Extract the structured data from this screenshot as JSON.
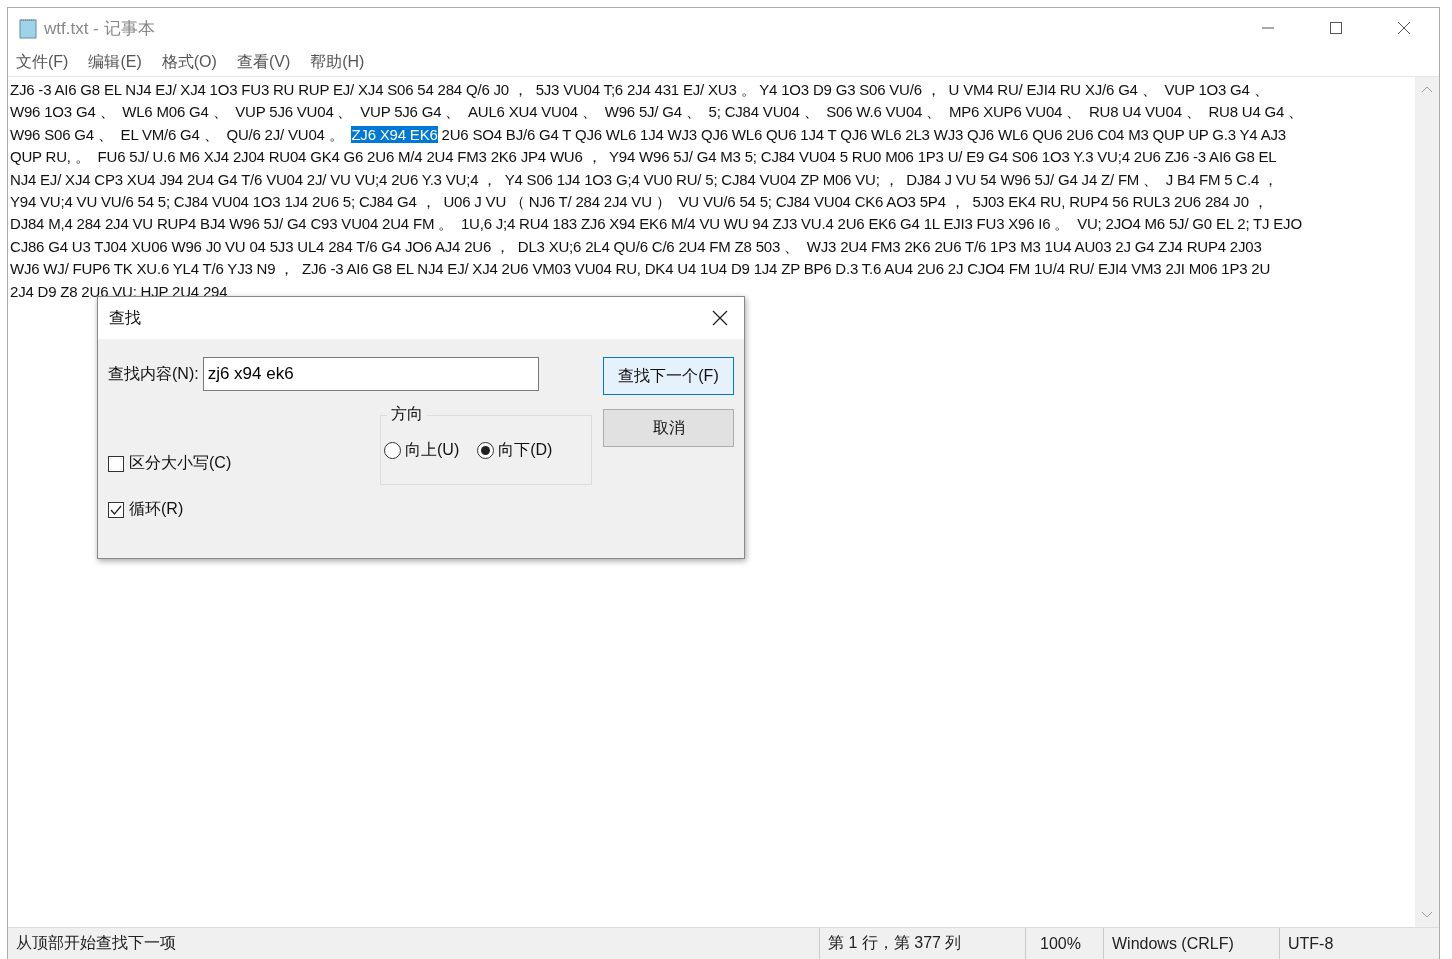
{
  "window": {
    "title": "wtf.txt - 记事本"
  },
  "menu": [
    "文件(F)",
    "编辑(E)",
    "格式(O)",
    "查看(V)",
    "帮助(H)"
  ],
  "editor": {
    "lines": [
      [
        {
          "text": "ZJ6 -3 AI6 G8 EL NJ4 EJ/ XJ4 1O3 FU3 RU RUP EJ/ XJ4 S06 54 284 Q/6 J0 ，  5J3 VU04 T;6 2J4 431 EJ/ XU3 。 Y4 1O3 D9 G3 S06 VU/6 ，  U VM4 RU/ EJI4 RU XJ/6 G4 、  VUP 1O3 G4 、",
          "selected": false
        }
      ],
      [
        {
          "text": "W96 1O3 G4 、  WL6 M06 G4 、  VUP 5J6 VU04 、  VUP 5J6 G4 、  AUL6 XU4 VU04 、  W96 5J/ G4 、  5; CJ84 VU04 、  S06 W.6 VU04 、  MP6 XUP6 VU04 、  RU8 U4 VU04 、  RU8 U4 G4 、",
          "selected": false
        }
      ],
      [
        {
          "text": "W96 S06 G4 、  EL VM/6 G4 、  QU/6 2J/ VU04 。  ",
          "selected": false
        },
        {
          "text": "ZJ6 X94 EK6",
          "selected": true
        },
        {
          "text": " 2U6 SO4 BJ/6 G4 T QJ6 WL6 1J4 WJ3 QJ6 WL6 QU6 1J4 T QJ6 WL6 2L3 WJ3 QJ6 WL6 QU6 2U6 C04 M3 QUP UP G.3 Y4 AJ3",
          "selected": false
        }
      ],
      [
        {
          "text": "QUP RU, 。  FU6 5J/ U.6 M6 XJ4 2J04 RU04 GK4 G6 2U6 M/4 2U4 FM3 2K6 JP4 WU6 ，  Y94 W96 5J/ G4 M3 5; CJ84 VU04 5 RU0 M06 1P3 U/ E9 G4 S06 1O3 Y.3 VU;4 2U6 ZJ6 -3 AI6 G8 EL",
          "selected": false
        }
      ],
      [
        {
          "text": "NJ4 EJ/ XJ4 CP3 XU4 J94 2U4 G4 T/6 VU04 2J/ VU VU;4 2U6 Y.3 VU;4 ，  Y4 S06 1J4 1O3 G;4 VU0 RU/ 5; CJ84 VU04 ZP M06 VU; ，  DJ84 J VU 54 W96 5J/ G4 J4 Z/ FM 、  J B4 FM 5 C.4 ，",
          "selected": false
        }
      ],
      [
        {
          "text": "Y94 VU;4 VU VU/6 54 5; CJ84 VU04 1O3 1J4 2U6 5; CJ84 G4 ，  U06 J VU （ NJ6 T/ 284 2J4 VU ）  VU VU/6 54 5; CJ84 VU04 CK6 AO3 5P4 ，  5J03 EK4 RU, RUP4 56 RUL3 2U6 284 J0 ，",
          "selected": false
        }
      ],
      [
        {
          "text": "DJ84 M,4 284 2J4 VU RUP4 BJ4 W96 5J/ G4 C93 VU04 2U4 FM 。  1U,6 J;4 RU4 183 ZJ6 X94 EK6 M/4 VU WU 94 ZJ3 VU.4 2U6 EK6 G4 1L EJI3 FU3 X96 I6 。  VU; 2JO4 M6 5J/ G0 EL 2; TJ EJO",
          "selected": false
        }
      ],
      [
        {
          "text": "CJ86 G4 U3 TJ04 XU06 W96 J0 VU 04 5J3 UL4 284 T/6 G4 JO6 AJ4 2U6 ，  DL3 XU;6 2L4 QU/6 C/6 2U4 FM Z8 503 、  WJ3 2U4 FM3 2K6 2U6 T/6 1P3 M3 1U4 AU03 2J G4 ZJ4 RUP4 2J03",
          "selected": false
        }
      ],
      [
        {
          "text": "WJ6 WJ/ FUP6 TK XU.6 YL4 T/6 YJ3 N9 ，  ZJ6 -3 AI6 G8 EL NJ4 EJ/ XJ4 2U6 VM03 VU04 RU, DK4 U4 1U4 D9 1J4 ZP BP6 D.3 T.6 AU4 2U6 2J CJO4 FM 1U/4 RU/ EJI4 VM3 2JI M06 1P3 2U",
          "selected": false
        }
      ],
      [
        {
          "text": "2J4 D9 Z8 2U6 VU; HJP 2U4 294",
          "selected": false
        }
      ]
    ]
  },
  "find_dialog": {
    "title": "查找",
    "find_label": "查找内容(N):",
    "find_value": "zj6 x94 ek6",
    "buttons": [
      {
        "label": "查找下一个(F)",
        "default": true
      },
      {
        "label": "取消",
        "default": false
      }
    ],
    "direction": {
      "label": "方向",
      "options": [
        {
          "label": "向上(U)",
          "selected": false
        },
        {
          "label": "向下(D)",
          "selected": true
        }
      ]
    },
    "checkboxes": [
      {
        "label": "区分大小写(C)",
        "checked": false
      },
      {
        "label": "循环(R)",
        "checked": true
      }
    ]
  },
  "status_bar": [
    "从顶部开始查找下一项",
    "第 1 行，第 377 列",
    "100%",
    "Windows (CRLF)",
    "UTF-8"
  ]
}
